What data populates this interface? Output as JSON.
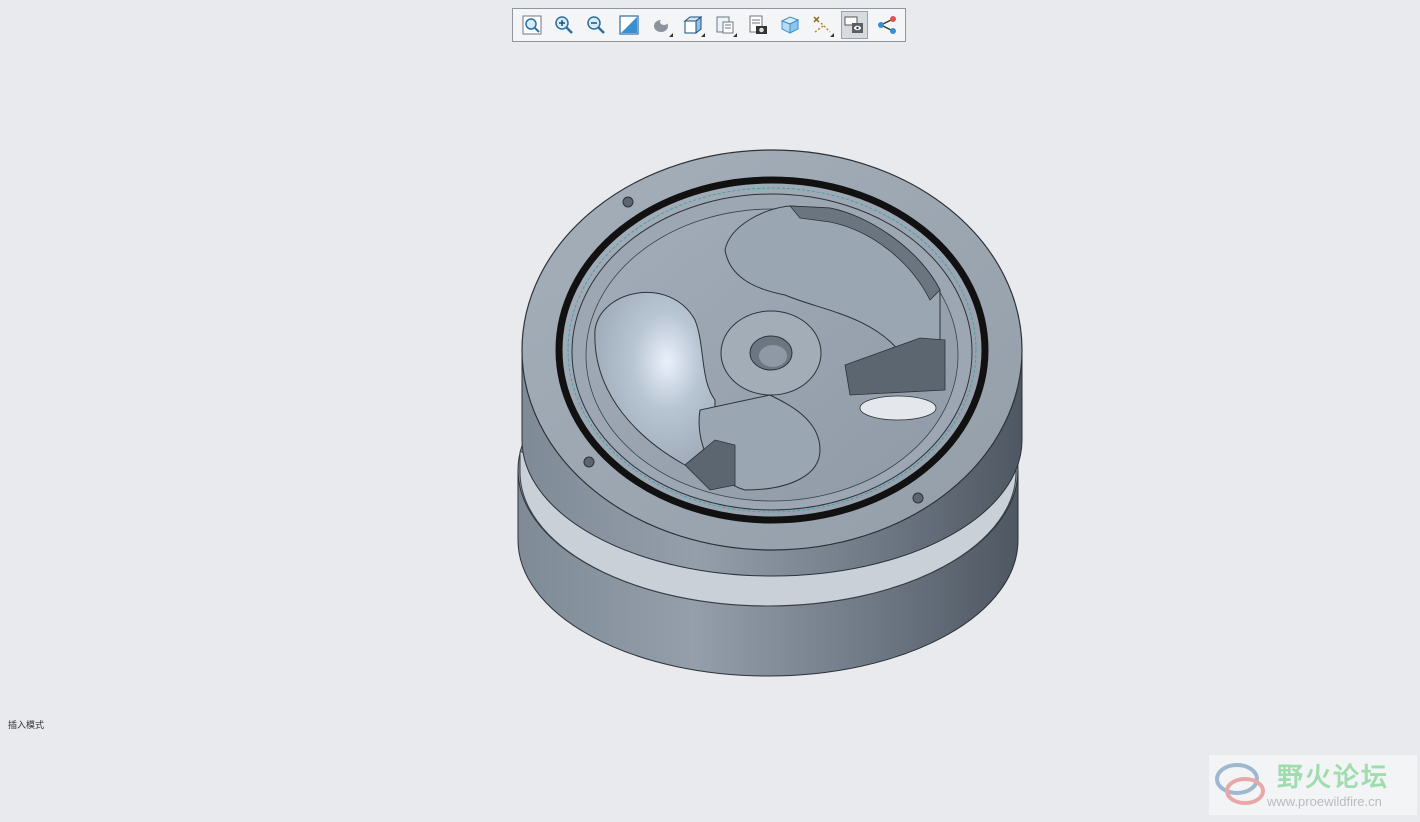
{
  "toolbar": {
    "buttons": [
      {
        "name": "refit",
        "icon": "zoom-fit-icon",
        "has_dropdown": false,
        "active": false
      },
      {
        "name": "zoom-in",
        "icon": "zoom-in-icon",
        "has_dropdown": false,
        "active": false
      },
      {
        "name": "zoom-out",
        "icon": "zoom-out-icon",
        "has_dropdown": false,
        "active": false
      },
      {
        "name": "repaint",
        "icon": "repaint-icon",
        "has_dropdown": false,
        "active": false
      },
      {
        "name": "display-style",
        "icon": "shading-icon",
        "has_dropdown": true,
        "active": false
      },
      {
        "name": "saved-orientations",
        "icon": "cube-orientation-icon",
        "has_dropdown": true,
        "active": false
      },
      {
        "name": "view-manager",
        "icon": "view-manager-icon",
        "has_dropdown": true,
        "active": false
      },
      {
        "name": "section",
        "icon": "camera-section-icon",
        "has_dropdown": false,
        "active": false
      },
      {
        "name": "perspective",
        "icon": "perspective-cube-icon",
        "has_dropdown": false,
        "active": false
      },
      {
        "name": "datum-display",
        "icon": "datum-display-icon",
        "has_dropdown": true,
        "active": false
      },
      {
        "name": "annotation-display",
        "icon": "annotation-display-icon",
        "has_dropdown": false,
        "active": true
      },
      {
        "name": "spin-center",
        "icon": "spin-center-icon",
        "has_dropdown": false,
        "active": false
      }
    ]
  },
  "status": {
    "text": "插入模式"
  },
  "watermark": {
    "title": "野火论坛",
    "url": "www.proewildfire.cn"
  },
  "colors": {
    "background": "#e8eaed",
    "model_body": "#9aa5b1",
    "model_dark": "#55606c",
    "seal_ring": "#111111",
    "watermark_green": "#9fdcae"
  }
}
